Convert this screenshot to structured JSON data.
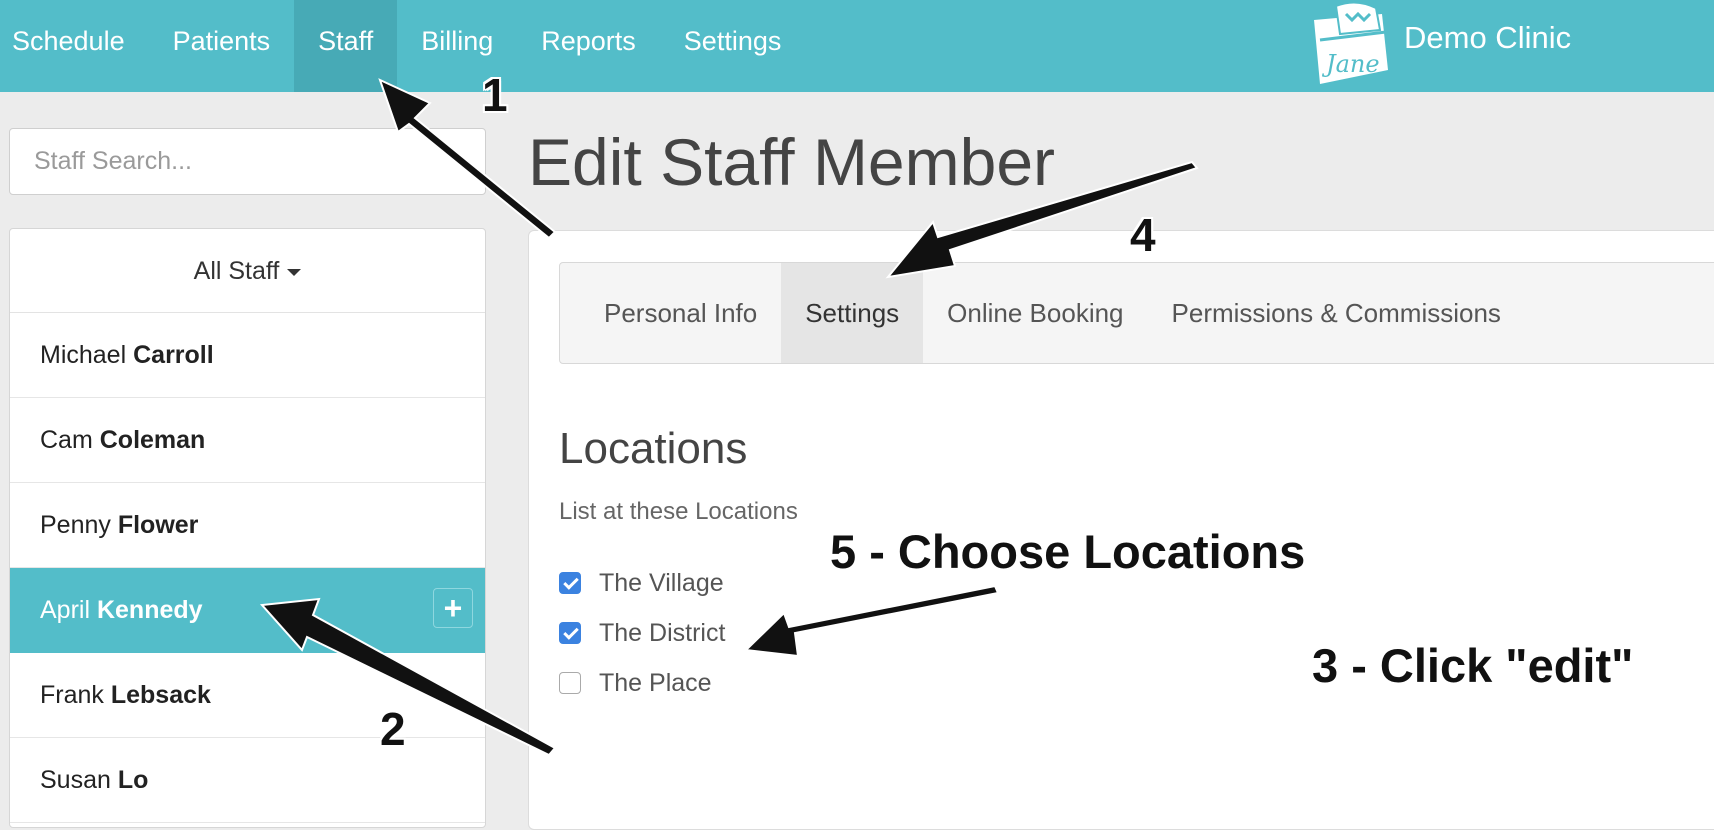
{
  "nav": {
    "items": [
      {
        "label": "Schedule"
      },
      {
        "label": "Patients"
      },
      {
        "label": "Staff",
        "active": true
      },
      {
        "label": "Billing"
      },
      {
        "label": "Reports"
      },
      {
        "label": "Settings"
      }
    ],
    "clinic_name": "Demo Clinic",
    "logo_text": "Jane"
  },
  "sidebar": {
    "search_placeholder": "Staff Search...",
    "filter_label": "All Staff",
    "staff": [
      {
        "first": "Michael",
        "last": "Carroll"
      },
      {
        "first": "Cam",
        "last": "Coleman"
      },
      {
        "first": "Penny",
        "last": "Flower"
      },
      {
        "first": "April",
        "last": "Kennedy",
        "selected": true
      },
      {
        "first": "Frank",
        "last": "Lebsack"
      },
      {
        "first": "Susan",
        "last": "Lo"
      }
    ],
    "add_button": "+"
  },
  "main": {
    "title": "Edit Staff Member",
    "tabs": [
      {
        "label": "Personal Info"
      },
      {
        "label": "Settings",
        "active": true
      },
      {
        "label": "Online Booking"
      },
      {
        "label": "Permissions & Commissions"
      }
    ],
    "locations": {
      "heading": "Locations",
      "subheading": "List at these Locations",
      "items": [
        {
          "label": "The Village",
          "checked": true
        },
        {
          "label": "The District",
          "checked": true
        },
        {
          "label": "The Place",
          "checked": false
        }
      ]
    }
  },
  "annotations": {
    "n1": "1",
    "n2": "2",
    "n3": "3 - Click \"edit\"",
    "n4": "4",
    "n5": "5 - Choose Locations"
  },
  "colors": {
    "brand": "#53bdc9",
    "brand_active": "#47aab6",
    "checkbox": "#3b82e0"
  }
}
